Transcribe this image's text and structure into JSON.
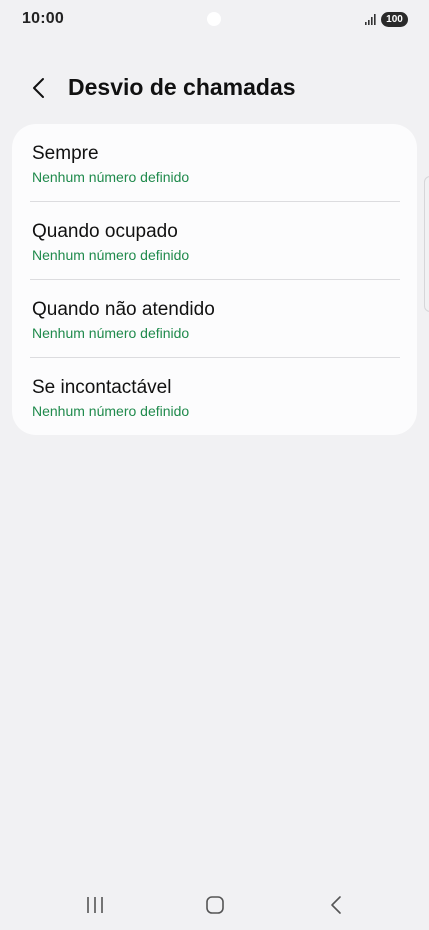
{
  "status_bar": {
    "time": "10:00",
    "battery": "100",
    "icons": [
      "signal-icon",
      "battery-icon"
    ]
  },
  "header": {
    "back_icon": "chevron-left-icon",
    "title": "Desvio de chamadas"
  },
  "options": [
    {
      "title": "Sempre",
      "subtitle": "Nenhum número definido"
    },
    {
      "title": "Quando ocupado",
      "subtitle": "Nenhum número definido"
    },
    {
      "title": "Quando não atendido",
      "subtitle": "Nenhum número definido"
    },
    {
      "title": "Se incontactável",
      "subtitle": "Nenhum número definido"
    }
  ],
  "nav_bar": {
    "icons": [
      "recents-icon",
      "home-icon",
      "back-icon"
    ]
  },
  "colors": {
    "background": "#f1f1f3",
    "card": "#fcfcfd",
    "subtitle_green": "#1f8a4c",
    "text": "#111111"
  }
}
